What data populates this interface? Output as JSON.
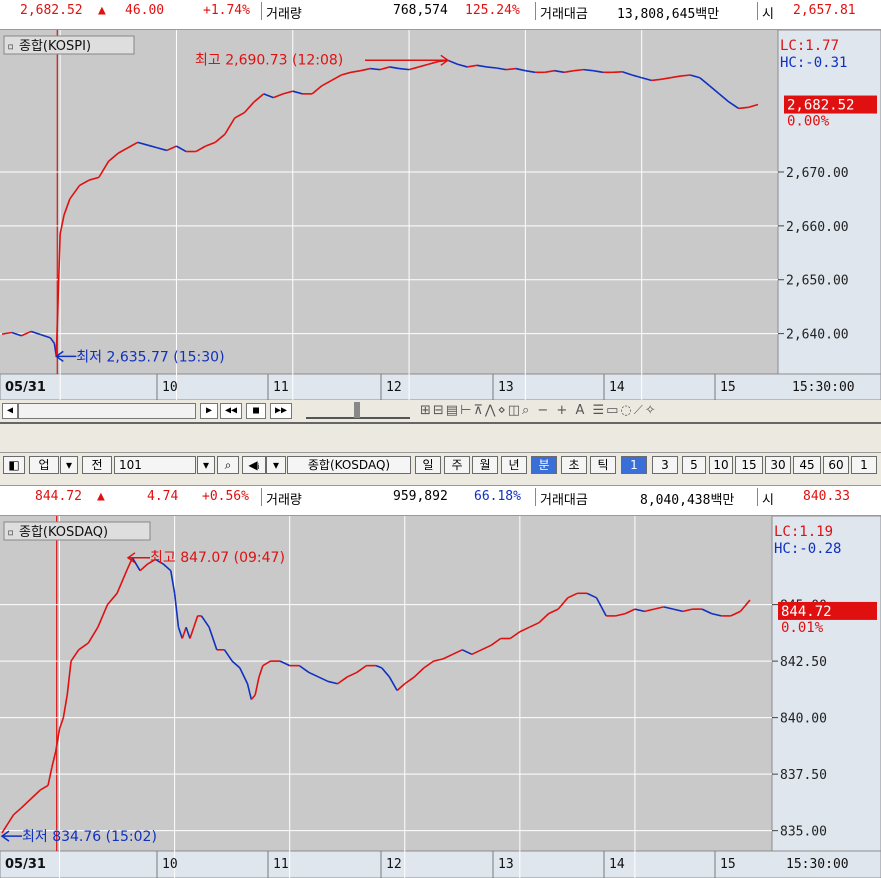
{
  "kospi_bar": {
    "price": "2,682.52",
    "change": "46.00",
    "pct": "+1.74%",
    "vol_label": "거래량",
    "vol": "768,574",
    "vol_pct": "125.24%",
    "amt_label": "거래대금",
    "amt": "13,808,645백만",
    "open_label": "시",
    "open": "2,657.81"
  },
  "kosdaq_bar": {
    "price": "844.72",
    "change": "4.74",
    "pct": "+0.56%",
    "vol_label": "거래량",
    "vol": "959,892",
    "vol_pct": "66.18%",
    "amt_label": "거래대금",
    "amt": "8,040,438백만",
    "open_label": "시",
    "open": "840.33"
  },
  "toolbar": {
    "type_label": "업",
    "prev_label": "전",
    "code": "101",
    "name": "종합(KOSDAQ)",
    "periods": [
      "일",
      "주",
      "월",
      "년",
      "분",
      "초",
      "틱"
    ],
    "active_period": "분",
    "intervals": [
      "1",
      "3",
      "5",
      "10",
      "15",
      "30",
      "45",
      "60",
      "1"
    ],
    "active_interval": "1"
  },
  "colors": {
    "up": "#e01010",
    "down": "#1030c0",
    "panel": "#c9c9c9",
    "axis_bg": "#ffffff"
  },
  "chart_data": [
    {
      "type": "line",
      "title": "종합(KOSPI)",
      "x_ticks": [
        "05/31",
        "10",
        "11",
        "12",
        "13",
        "14",
        "15"
      ],
      "time_label": "15:30:00",
      "y_ticks": [
        "2,640.00",
        "2,650.00",
        "2,660.00",
        "2,670.00"
      ],
      "ylim": [
        2632.5,
        2694.5
      ],
      "x_range": [
        0,
        390
      ],
      "hi_label": "최고 2,690.73 (12:08)",
      "lo_label": "최저 2,635.77 (15:30)",
      "lc_label": "LC:1.77",
      "hc_label": "HC:-0.31",
      "current": "2,682.52",
      "current_pct": "0.00%",
      "current_value": 2682.52,
      "points": [
        [
          0,
          2639.9
        ],
        [
          5,
          2640.2
        ],
        [
          10,
          2639.6
        ],
        [
          15,
          2640.4
        ],
        [
          20,
          2639.8
        ],
        [
          25,
          2639.2
        ],
        [
          27,
          2638.2
        ],
        [
          28,
          2635.8
        ],
        [
          30,
          2658.5
        ],
        [
          32,
          2662
        ],
        [
          35,
          2665
        ],
        [
          40,
          2667.5
        ],
        [
          45,
          2668.5
        ],
        [
          50,
          2669
        ],
        [
          55,
          2672
        ],
        [
          60,
          2673.5
        ],
        [
          65,
          2674.5
        ],
        [
          70,
          2675.5
        ],
        [
          75,
          2675
        ],
        [
          80,
          2674.5
        ],
        [
          85,
          2674
        ],
        [
          90,
          2674.8
        ],
        [
          95,
          2673.8
        ],
        [
          100,
          2673.8
        ],
        [
          105,
          2674.8
        ],
        [
          110,
          2675.5
        ],
        [
          115,
          2677
        ],
        [
          120,
          2680
        ],
        [
          125,
          2681
        ],
        [
          130,
          2683
        ],
        [
          135,
          2684.5
        ],
        [
          140,
          2683.8
        ],
        [
          145,
          2684.5
        ],
        [
          150,
          2685
        ],
        [
          155,
          2684.5
        ],
        [
          160,
          2684.5
        ],
        [
          165,
          2686
        ],
        [
          170,
          2687
        ],
        [
          175,
          2688
        ],
        [
          180,
          2688.5
        ],
        [
          185,
          2688.8
        ],
        [
          190,
          2689.2
        ],
        [
          195,
          2689
        ],
        [
          200,
          2689.5
        ],
        [
          205,
          2689.2
        ],
        [
          210,
          2689
        ],
        [
          215,
          2689.5
        ],
        [
          220,
          2690
        ],
        [
          225,
          2690.5
        ],
        [
          230,
          2690.73
        ],
        [
          235,
          2690
        ],
        [
          240,
          2689.5
        ],
        [
          245,
          2689.8
        ],
        [
          250,
          2689.5
        ],
        [
          255,
          2689.3
        ],
        [
          260,
          2689
        ],
        [
          265,
          2689.2
        ],
        [
          270,
          2688.8
        ],
        [
          275,
          2688.5
        ],
        [
          280,
          2688.5
        ],
        [
          285,
          2688.8
        ],
        [
          290,
          2688.5
        ],
        [
          295,
          2688.8
        ],
        [
          300,
          2689
        ],
        [
          305,
          2688.8
        ],
        [
          310,
          2688.5
        ],
        [
          315,
          2688.5
        ],
        [
          320,
          2688.6
        ],
        [
          325,
          2688
        ],
        [
          330,
          2687.5
        ],
        [
          335,
          2687
        ],
        [
          340,
          2687.2
        ],
        [
          345,
          2687.5
        ],
        [
          350,
          2687.8
        ],
        [
          355,
          2688
        ],
        [
          360,
          2687.5
        ],
        [
          365,
          2686
        ],
        [
          370,
          2684.5
        ],
        [
          375,
          2683
        ],
        [
          380,
          2681.8
        ],
        [
          385,
          2682
        ],
        [
          390,
          2682.52
        ]
      ]
    },
    {
      "type": "line",
      "title": "종합(KOSDAQ)",
      "x_ticks": [
        "05/31",
        "10",
        "11",
        "12",
        "13",
        "14",
        "15"
      ],
      "time_label": "15:30:00",
      "y_ticks": [
        "835.00",
        "837.50",
        "840.00",
        "842.50",
        "845.00"
      ],
      "ylim": [
        834.1,
        848.3
      ],
      "x_range": [
        0,
        390
      ],
      "hi_label": "최고 847.07 (09:47)",
      "lo_label": "최저 834.76 (15:02)",
      "lc_label": "LC:1.19",
      "hc_label": "HC:-0.28",
      "current": "844.72",
      "current_pct": "0.01%",
      "current_value": 844.72,
      "points": [
        [
          0,
          834.9
        ],
        [
          3,
          835.3
        ],
        [
          6,
          835.7
        ],
        [
          10,
          836
        ],
        [
          15,
          836.4
        ],
        [
          20,
          836.8
        ],
        [
          24,
          837
        ],
        [
          26,
          837.8
        ],
        [
          28,
          838.5
        ],
        [
          30,
          839.5
        ],
        [
          32,
          840
        ],
        [
          34,
          841
        ],
        [
          36,
          842.5
        ],
        [
          40,
          843
        ],
        [
          45,
          843.3
        ],
        [
          50,
          844
        ],
        [
          55,
          845
        ],
        [
          60,
          845.5
        ],
        [
          65,
          846.5
        ],
        [
          68,
          847.07
        ],
        [
          72,
          846.5
        ],
        [
          76,
          846.8
        ],
        [
          80,
          847
        ],
        [
          84,
          846.8
        ],
        [
          88,
          846.5
        ],
        [
          90,
          845.5
        ],
        [
          92,
          844
        ],
        [
          94,
          843.5
        ],
        [
          96,
          844
        ],
        [
          98,
          843.5
        ],
        [
          100,
          844
        ],
        [
          102,
          844.5
        ],
        [
          104,
          844.5
        ],
        [
          108,
          844
        ],
        [
          112,
          843
        ],
        [
          116,
          843
        ],
        [
          120,
          842.5
        ],
        [
          124,
          842.2
        ],
        [
          128,
          841.5
        ],
        [
          130,
          840.8
        ],
        [
          132,
          841
        ],
        [
          134,
          841.8
        ],
        [
          136,
          842.3
        ],
        [
          140,
          842.5
        ],
        [
          145,
          842.5
        ],
        [
          150,
          842.3
        ],
        [
          155,
          842.3
        ],
        [
          160,
          842
        ],
        [
          165,
          841.8
        ],
        [
          170,
          841.6
        ],
        [
          175,
          841.5
        ],
        [
          180,
          841.8
        ],
        [
          185,
          842
        ],
        [
          190,
          842.3
        ],
        [
          195,
          842.3
        ],
        [
          198,
          842.2
        ],
        [
          202,
          841.8
        ],
        [
          206,
          841.2
        ],
        [
          210,
          841.5
        ],
        [
          215,
          841.8
        ],
        [
          220,
          842.2
        ],
        [
          225,
          842.5
        ],
        [
          230,
          842.6
        ],
        [
          235,
          842.8
        ],
        [
          240,
          843
        ],
        [
          245,
          842.8
        ],
        [
          250,
          843
        ],
        [
          255,
          843.2
        ],
        [
          260,
          843.5
        ],
        [
          265,
          843.5
        ],
        [
          270,
          843.8
        ],
        [
          275,
          844
        ],
        [
          280,
          844.2
        ],
        [
          285,
          844.6
        ],
        [
          290,
          844.8
        ],
        [
          295,
          845.3
        ],
        [
          300,
          845.5
        ],
        [
          305,
          845.5
        ],
        [
          310,
          845.3
        ],
        [
          315,
          844.5
        ],
        [
          320,
          844.5
        ],
        [
          325,
          844.6
        ],
        [
          330,
          844.8
        ],
        [
          335,
          844.7
        ],
        [
          340,
          844.8
        ],
        [
          345,
          844.9
        ],
        [
          350,
          844.8
        ],
        [
          355,
          844.7
        ],
        [
          360,
          844.8
        ],
        [
          365,
          844.8
        ],
        [
          370,
          844.6
        ],
        [
          375,
          844.5
        ],
        [
          380,
          844.5
        ],
        [
          385,
          844.7
        ],
        [
          390,
          845.2
        ]
      ]
    }
  ]
}
